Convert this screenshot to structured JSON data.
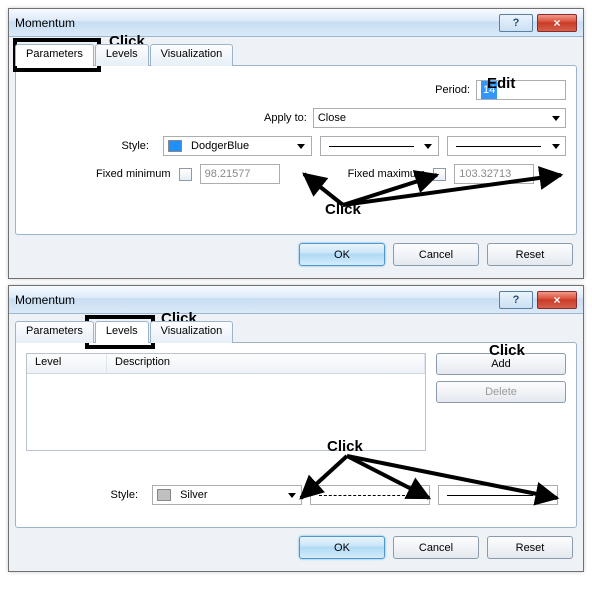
{
  "dialogs": [
    {
      "title": "Momentum",
      "helpmark": "?",
      "closemark": "×",
      "tabs": {
        "parameters": "Parameters",
        "levels": "Levels",
        "visualization": "Visualization"
      },
      "active_tab": "Parameters",
      "period_label": "Period:",
      "period_value": "14",
      "applyto_label": "Apply to:",
      "applyto_value": "Close",
      "style_label": "Style:",
      "style_color_name": "DodgerBlue",
      "style_color_hex": "#1e90ff",
      "fixedmin_label": "Fixed minimum",
      "fixedmin_value": "98.21577",
      "fixedmin_checked": false,
      "fixedmax_label": "Fixed maximum",
      "fixedmax_value": "103.32713",
      "fixedmax_checked": false,
      "buttons": {
        "ok": "OK",
        "cancel": "Cancel",
        "reset": "Reset"
      },
      "annot": {
        "click_tab": "Click",
        "edit": "Edit",
        "click_style": "Click"
      }
    },
    {
      "title": "Momentum",
      "helpmark": "?",
      "closemark": "×",
      "tabs": {
        "parameters": "Parameters",
        "levels": "Levels",
        "visualization": "Visualization"
      },
      "active_tab": "Levels",
      "table": {
        "col_level": "Level",
        "col_desc": "Description"
      },
      "sidebuttons": {
        "add": "Add",
        "delete": "Delete"
      },
      "style_label": "Style:",
      "style_color_name": "Silver",
      "style_color_hex": "#c0c0c0",
      "buttons": {
        "ok": "OK",
        "cancel": "Cancel",
        "reset": "Reset"
      },
      "annot": {
        "click_tab": "Click",
        "click_add": "Click",
        "click_style": "Click"
      }
    }
  ]
}
